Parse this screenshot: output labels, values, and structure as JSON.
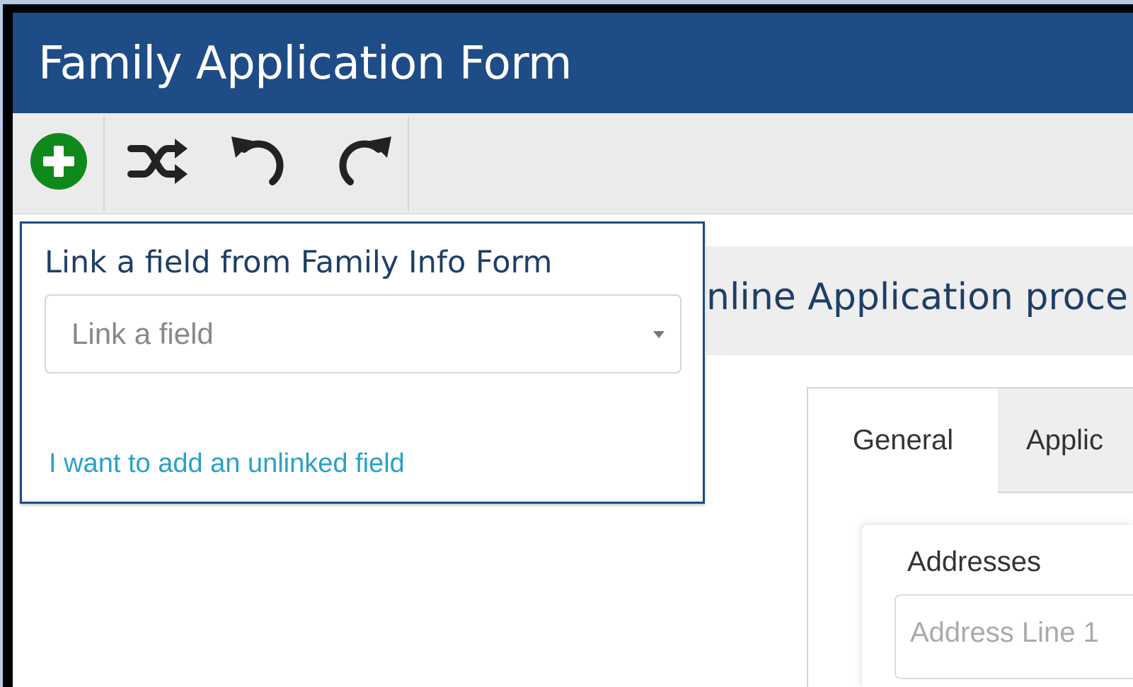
{
  "window": {
    "title": "Family Application Form"
  },
  "toolbar": {
    "tools": [
      {
        "name": "add",
        "icon": "plus-circle-icon"
      },
      {
        "name": "shuffle",
        "icon": "shuffle-icon"
      },
      {
        "name": "undo",
        "icon": "undo-icon"
      },
      {
        "name": "redo",
        "icon": "redo-icon"
      }
    ]
  },
  "popup": {
    "title": "Link a field from Family Info Form",
    "select_placeholder": "Link a field",
    "unlinked_link": "I want to add an unlinked field"
  },
  "main": {
    "heading": "nline Application proce",
    "tabs": [
      {
        "label": "General",
        "active": true
      },
      {
        "label": "Applic",
        "active": false
      }
    ],
    "section_label": "Addresses",
    "address_placeholder": "Address Line 1"
  },
  "colors": {
    "header": "#1e4c86",
    "add_button": "#0f8a1a",
    "link": "#2aa0c8"
  }
}
